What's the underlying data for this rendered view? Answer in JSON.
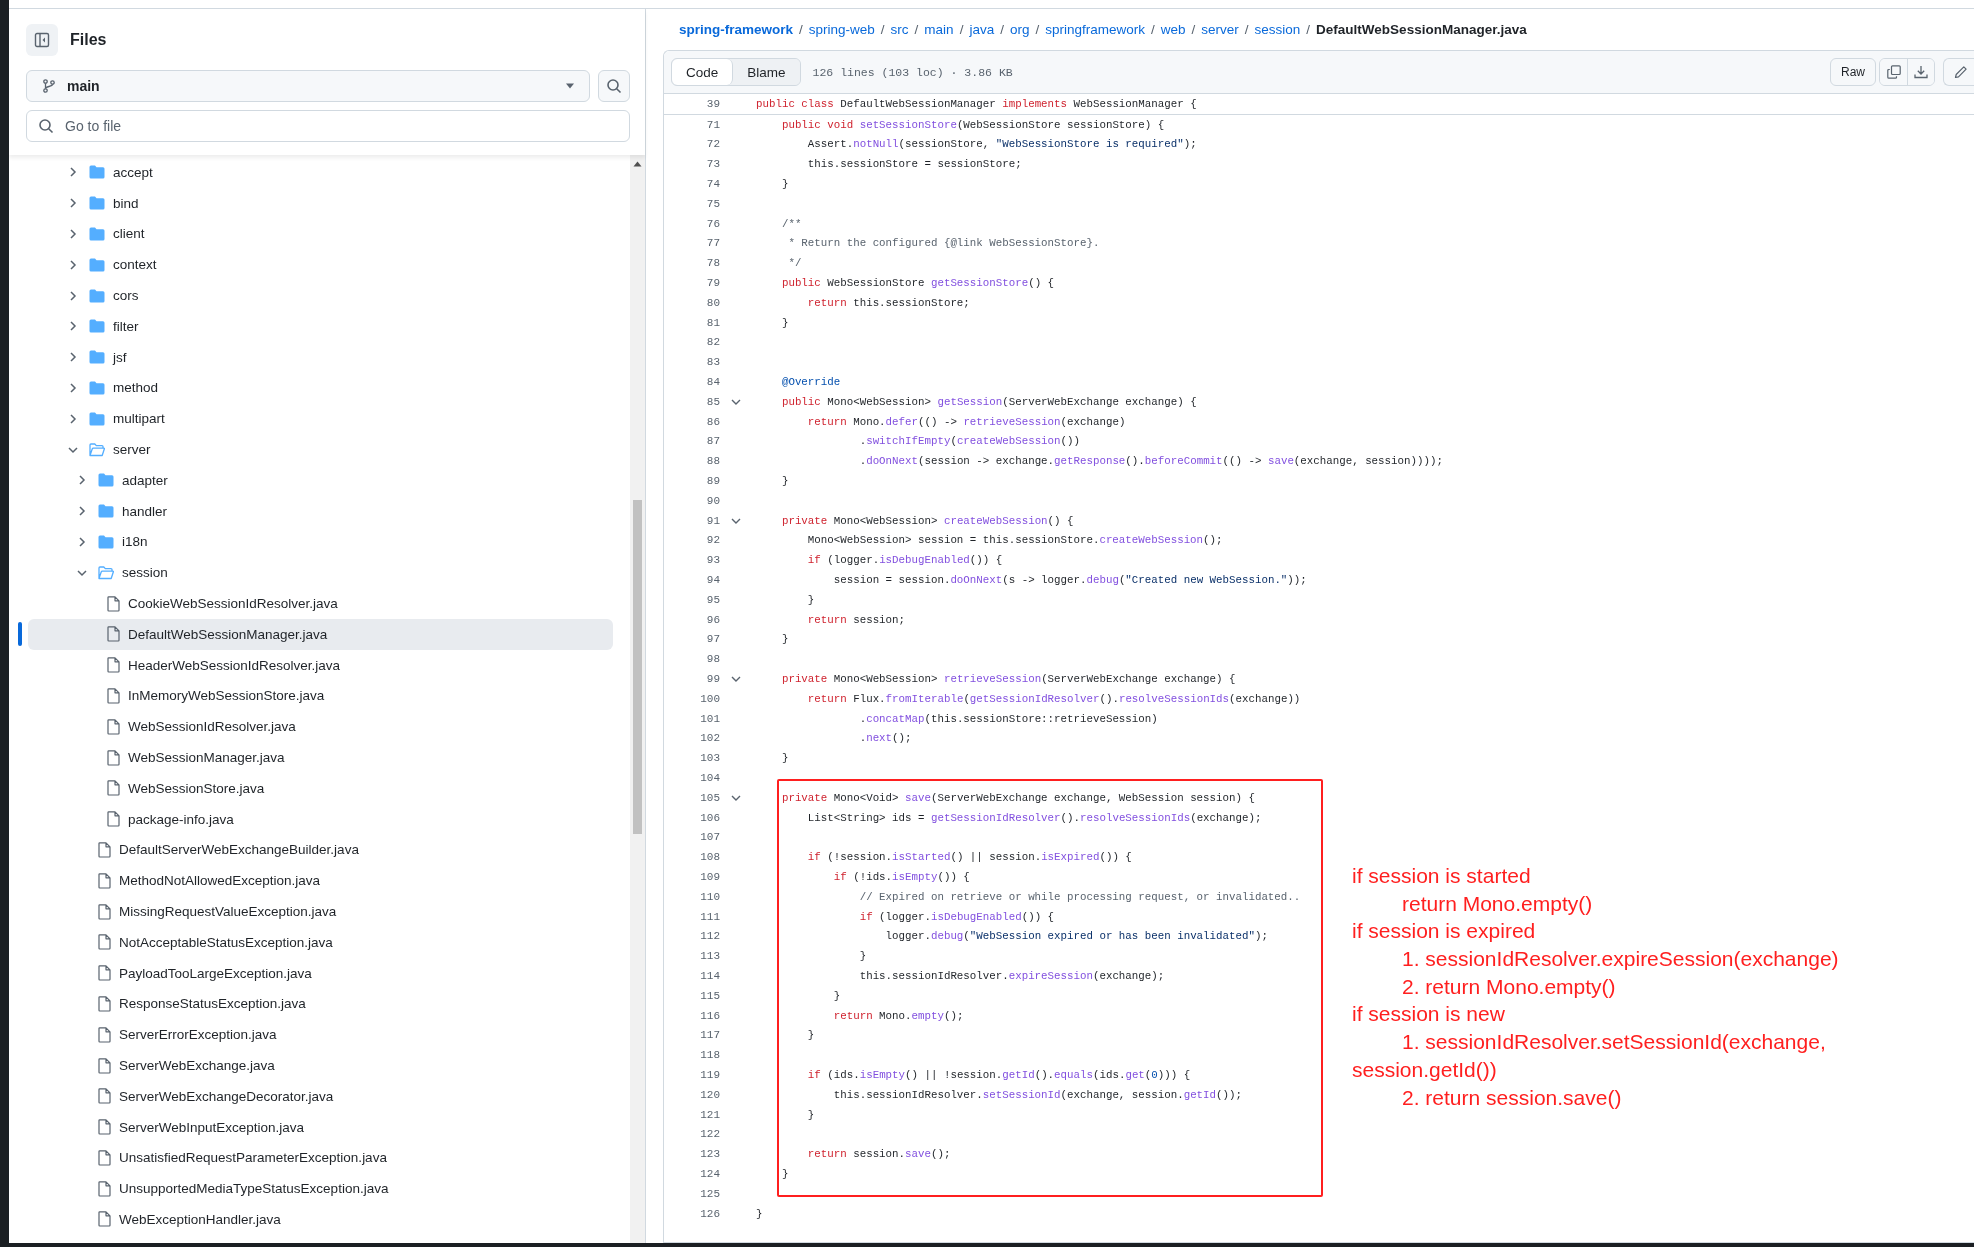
{
  "sidebar": {
    "title": "Files",
    "branch": "main",
    "search": {
      "placeholder": "Go to file"
    },
    "tree": [
      {
        "name": "accept",
        "kind": "folder",
        "expanded": false,
        "selected": false
      },
      {
        "name": "bind",
        "kind": "folder",
        "expanded": false,
        "selected": false
      },
      {
        "name": "client",
        "kind": "folder",
        "expanded": false,
        "selected": false
      },
      {
        "name": "context",
        "kind": "folder",
        "expanded": false,
        "selected": false
      },
      {
        "name": "cors",
        "kind": "folder",
        "expanded": false,
        "selected": false
      },
      {
        "name": "filter",
        "kind": "folder",
        "expanded": false,
        "selected": false
      },
      {
        "name": "jsf",
        "kind": "folder",
        "expanded": false,
        "selected": false
      },
      {
        "name": "method",
        "kind": "folder",
        "expanded": false,
        "selected": false
      },
      {
        "name": "multipart",
        "kind": "folder",
        "expanded": false,
        "selected": false
      },
      {
        "name": "server",
        "kind": "folder",
        "expanded": true,
        "selected": false,
        "children": [
          {
            "name": "adapter",
            "kind": "folder",
            "expanded": false,
            "selected": false
          },
          {
            "name": "handler",
            "kind": "folder",
            "expanded": false,
            "selected": false
          },
          {
            "name": "i18n",
            "kind": "folder",
            "expanded": false,
            "selected": false
          },
          {
            "name": "session",
            "kind": "folder",
            "expanded": true,
            "selected": false,
            "children": [
              {
                "name": "CookieWebSessionIdResolver.java",
                "kind": "file",
                "selected": false
              },
              {
                "name": "DefaultWebSessionManager.java",
                "kind": "file",
                "selected": true
              },
              {
                "name": "HeaderWebSessionIdResolver.java",
                "kind": "file",
                "selected": false
              },
              {
                "name": "InMemoryWebSessionStore.java",
                "kind": "file",
                "selected": false
              },
              {
                "name": "WebSessionIdResolver.java",
                "kind": "file",
                "selected": false
              },
              {
                "name": "WebSessionManager.java",
                "kind": "file",
                "selected": false
              },
              {
                "name": "WebSessionStore.java",
                "kind": "file",
                "selected": false
              },
              {
                "name": "package-info.java",
                "kind": "file",
                "selected": false
              }
            ]
          },
          {
            "name": "DefaultServerWebExchangeBuilder.java",
            "kind": "file",
            "selected": false
          },
          {
            "name": "MethodNotAllowedException.java",
            "kind": "file",
            "selected": false
          },
          {
            "name": "MissingRequestValueException.java",
            "kind": "file",
            "selected": false
          },
          {
            "name": "NotAcceptableStatusException.java",
            "kind": "file",
            "selected": false
          },
          {
            "name": "PayloadTooLargeException.java",
            "kind": "file",
            "selected": false
          },
          {
            "name": "ResponseStatusException.java",
            "kind": "file",
            "selected": false
          },
          {
            "name": "ServerErrorException.java",
            "kind": "file",
            "selected": false
          },
          {
            "name": "ServerWebExchange.java",
            "kind": "file",
            "selected": false
          },
          {
            "name": "ServerWebExchangeDecorator.java",
            "kind": "file",
            "selected": false
          },
          {
            "name": "ServerWebInputException.java",
            "kind": "file",
            "selected": false
          },
          {
            "name": "UnsatisfiedRequestParameterException.java",
            "kind": "file",
            "selected": false
          },
          {
            "name": "UnsupportedMediaTypeStatusException.java",
            "kind": "file",
            "selected": false
          },
          {
            "name": "WebExceptionHandler.java",
            "kind": "file",
            "selected": false
          }
        ]
      }
    ]
  },
  "breadcrumb": [
    {
      "kind": "repo",
      "text": "spring-framework"
    },
    {
      "kind": "separator",
      "text": "/"
    },
    {
      "kind": "link",
      "text": "spring-web"
    },
    {
      "kind": "separator",
      "text": "/"
    },
    {
      "kind": "link",
      "text": "src"
    },
    {
      "kind": "separator",
      "text": "/"
    },
    {
      "kind": "link",
      "text": "main"
    },
    {
      "kind": "separator",
      "text": "/"
    },
    {
      "kind": "link",
      "text": "java"
    },
    {
      "kind": "separator",
      "text": "/"
    },
    {
      "kind": "link",
      "text": "org"
    },
    {
      "kind": "separator",
      "text": "/"
    },
    {
      "kind": "link",
      "text": "springframework"
    },
    {
      "kind": "separator",
      "text": "/"
    },
    {
      "kind": "link",
      "text": "web"
    },
    {
      "kind": "separator",
      "text": "/"
    },
    {
      "kind": "link",
      "text": "server"
    },
    {
      "kind": "separator",
      "text": "/"
    },
    {
      "kind": "link",
      "text": "session"
    },
    {
      "kind": "separator",
      "text": "/"
    },
    {
      "kind": "current",
      "text": "DefaultWebSessionManager.java"
    }
  ],
  "file": {
    "tabs": [
      {
        "label": "Code",
        "selected": true
      },
      {
        "label": "Blame",
        "selected": false
      }
    ],
    "info": "126 lines (103 loc) · 3.86 KB",
    "raw_button": "Raw"
  },
  "code": {
    "sticky": {
      "n": "39",
      "tokens": [
        {
          "kind": "kw",
          "text": "public class"
        },
        {
          "kind": "p",
          "text": " DefaultWebSessionManager "
        },
        {
          "kind": "kw",
          "text": "implements"
        },
        {
          "kind": "p",
          "text": " WebSessionManager {"
        }
      ]
    },
    "blocks": [
      {
        "boxed": false,
        "lines": [
          {
            "n": "71",
            "fold": false,
            "tokens": [
              {
                "kind": "kw",
                "text": "    public void "
              },
              {
                "kind": "fn",
                "text": "setSessionStore"
              },
              {
                "kind": "p",
                "text": "(WebSessionStore sessionStore) {"
              }
            ]
          },
          {
            "n": "72",
            "fold": false,
            "tokens": [
              {
                "kind": "p",
                "text": "        Assert."
              },
              {
                "kind": "fn",
                "text": "notNull"
              },
              {
                "kind": "p",
                "text": "(sessionStore, "
              },
              {
                "kind": "str",
                "text": "\"WebSessionStore is required\""
              },
              {
                "kind": "p",
                "text": ");"
              }
            ]
          },
          {
            "n": "73",
            "fold": false,
            "tokens": [
              {
                "kind": "p",
                "text": "        this.sessionStore = sessionStore;"
              }
            ]
          },
          {
            "n": "74",
            "fold": false,
            "tokens": [
              {
                "kind": "p",
                "text": "    }"
              }
            ]
          },
          {
            "n": "75",
            "fold": false
          },
          {
            "n": "76",
            "fold": false,
            "tokens": [
              {
                "kind": "cm",
                "text": "    /**"
              }
            ]
          },
          {
            "n": "77",
            "fold": false,
            "tokens": [
              {
                "kind": "cm",
                "text": "     * Return the configured {@link WebSessionStore}."
              }
            ]
          },
          {
            "n": "78",
            "fold": false,
            "tokens": [
              {
                "kind": "cm",
                "text": "     */"
              }
            ]
          },
          {
            "n": "79",
            "fold": false,
            "tokens": [
              {
                "kind": "kw",
                "text": "    public"
              },
              {
                "kind": "p",
                "text": " WebSessionStore "
              },
              {
                "kind": "fn",
                "text": "getSessionStore"
              },
              {
                "kind": "p",
                "text": "() {"
              }
            ]
          },
          {
            "n": "80",
            "fold": false,
            "tokens": [
              {
                "kind": "kw",
                "text": "        return"
              },
              {
                "kind": "p",
                "text": " this.sessionStore;"
              }
            ]
          },
          {
            "n": "81",
            "fold": false,
            "tokens": [
              {
                "kind": "p",
                "text": "    }"
              }
            ]
          },
          {
            "n": "82",
            "fold": false
          },
          {
            "n": "83",
            "fold": false
          },
          {
            "n": "84",
            "fold": false,
            "tokens": [
              {
                "kind": "ann",
                "text": "    @Override"
              }
            ]
          },
          {
            "n": "85",
            "fold": true,
            "tokens": [
              {
                "kind": "kw",
                "text": "    public"
              },
              {
                "kind": "p",
                "text": " Mono<WebSession> "
              },
              {
                "kind": "fn",
                "text": "getSession"
              },
              {
                "kind": "p",
                "text": "(ServerWebExchange exchange) {"
              }
            ]
          },
          {
            "n": "86",
            "fold": false,
            "tokens": [
              {
                "kind": "kw",
                "text": "        return"
              },
              {
                "kind": "p",
                "text": " Mono."
              },
              {
                "kind": "fn",
                "text": "defer"
              },
              {
                "kind": "p",
                "text": "(() -> "
              },
              {
                "kind": "fn",
                "text": "retrieveSession"
              },
              {
                "kind": "p",
                "text": "(exchange)"
              }
            ]
          },
          {
            "n": "87",
            "fold": false,
            "tokens": [
              {
                "kind": "p",
                "text": "                ."
              },
              {
                "kind": "fn",
                "text": "switchIfEmpty"
              },
              {
                "kind": "p",
                "text": "("
              },
              {
                "kind": "fn",
                "text": "createWebSession"
              },
              {
                "kind": "p",
                "text": "())"
              }
            ]
          },
          {
            "n": "88",
            "fold": false,
            "tokens": [
              {
                "kind": "p",
                "text": "                ."
              },
              {
                "kind": "fn",
                "text": "doOnNext"
              },
              {
                "kind": "p",
                "text": "(session -> exchange."
              },
              {
                "kind": "fn",
                "text": "getResponse"
              },
              {
                "kind": "p",
                "text": "()."
              },
              {
                "kind": "fn",
                "text": "beforeCommit"
              },
              {
                "kind": "p",
                "text": "(() -> "
              },
              {
                "kind": "fn",
                "text": "save"
              },
              {
                "kind": "p",
                "text": "(exchange, session))));"
              }
            ]
          },
          {
            "n": "89",
            "fold": false,
            "tokens": [
              {
                "kind": "p",
                "text": "    }"
              }
            ]
          },
          {
            "n": "90",
            "fold": false
          },
          {
            "n": "91",
            "fold": true,
            "tokens": [
              {
                "kind": "kw",
                "text": "    private"
              },
              {
                "kind": "p",
                "text": " Mono<WebSession> "
              },
              {
                "kind": "fn",
                "text": "createWebSession"
              },
              {
                "kind": "p",
                "text": "() {"
              }
            ]
          },
          {
            "n": "92",
            "fold": false,
            "tokens": [
              {
                "kind": "p",
                "text": "        Mono<WebSession> session = this.sessionStore."
              },
              {
                "kind": "fn",
                "text": "createWebSession"
              },
              {
                "kind": "p",
                "text": "();"
              }
            ]
          },
          {
            "n": "93",
            "fold": false,
            "tokens": [
              {
                "kind": "kw",
                "text": "        if"
              },
              {
                "kind": "p",
                "text": " (logger."
              },
              {
                "kind": "fn",
                "text": "isDebugEnabled"
              },
              {
                "kind": "p",
                "text": "()) {"
              }
            ]
          },
          {
            "n": "94",
            "fold": false,
            "tokens": [
              {
                "kind": "p",
                "text": "            session = session."
              },
              {
                "kind": "fn",
                "text": "doOnNext"
              },
              {
                "kind": "p",
                "text": "(s -> logger."
              },
              {
                "kind": "fn",
                "text": "debug"
              },
              {
                "kind": "p",
                "text": "("
              },
              {
                "kind": "str",
                "text": "\"Created new WebSession.\""
              },
              {
                "kind": "p",
                "text": "));"
              }
            ]
          },
          {
            "n": "95",
            "fold": false,
            "tokens": [
              {
                "kind": "p",
                "text": "        }"
              }
            ]
          },
          {
            "n": "96",
            "fold": false,
            "tokens": [
              {
                "kind": "kw",
                "text": "        return"
              },
              {
                "kind": "p",
                "text": " session;"
              }
            ]
          },
          {
            "n": "97",
            "fold": false,
            "tokens": [
              {
                "kind": "p",
                "text": "    }"
              }
            ]
          },
          {
            "n": "98",
            "fold": false
          },
          {
            "n": "99",
            "fold": true,
            "tokens": [
              {
                "kind": "kw",
                "text": "    private"
              },
              {
                "kind": "p",
                "text": " Mono<WebSession> "
              },
              {
                "kind": "fn",
                "text": "retrieveSession"
              },
              {
                "kind": "p",
                "text": "(ServerWebExchange exchange) {"
              }
            ]
          },
          {
            "n": "100",
            "fold": false,
            "tokens": [
              {
                "kind": "kw",
                "text": "        return"
              },
              {
                "kind": "p",
                "text": " Flux."
              },
              {
                "kind": "fn",
                "text": "fromIterable"
              },
              {
                "kind": "p",
                "text": "("
              },
              {
                "kind": "fn",
                "text": "getSessionIdResolver"
              },
              {
                "kind": "p",
                "text": "()."
              },
              {
                "kind": "fn",
                "text": "resolveSessionIds"
              },
              {
                "kind": "p",
                "text": "(exchange))"
              }
            ]
          },
          {
            "n": "101",
            "fold": false,
            "tokens": [
              {
                "kind": "p",
                "text": "                ."
              },
              {
                "kind": "fn",
                "text": "concatMap"
              },
              {
                "kind": "p",
                "text": "(this.sessionStore::retrieveSession)"
              }
            ]
          },
          {
            "n": "102",
            "fold": false,
            "tokens": [
              {
                "kind": "p",
                "text": "                ."
              },
              {
                "kind": "fn",
                "text": "next"
              },
              {
                "kind": "p",
                "text": "();"
              }
            ]
          },
          {
            "n": "103",
            "fold": false,
            "tokens": [
              {
                "kind": "p",
                "text": "    }"
              }
            ]
          },
          {
            "n": "104",
            "fold": false
          }
        ]
      },
      {
        "boxed": true,
        "lines": [
          {
            "n": "105",
            "fold": true,
            "tokens": [
              {
                "kind": "kw",
                "text": "    private"
              },
              {
                "kind": "p",
                "text": " Mono<Void> "
              },
              {
                "kind": "fn",
                "text": "save"
              },
              {
                "kind": "p",
                "text": "(ServerWebExchange exchange, WebSession session) {"
              }
            ]
          },
          {
            "n": "106",
            "fold": false,
            "tokens": [
              {
                "kind": "p",
                "text": "        List<String> ids = "
              },
              {
                "kind": "fn",
                "text": "getSessionIdResolver"
              },
              {
                "kind": "p",
                "text": "()."
              },
              {
                "kind": "fn",
                "text": "resolveSessionIds"
              },
              {
                "kind": "p",
                "text": "(exchange);"
              }
            ]
          },
          {
            "n": "107",
            "fold": false
          },
          {
            "n": "108",
            "fold": false,
            "tokens": [
              {
                "kind": "kw",
                "text": "        if"
              },
              {
                "kind": "p",
                "text": " (!session."
              },
              {
                "kind": "fn",
                "text": "isStarted"
              },
              {
                "kind": "p",
                "text": "() || session."
              },
              {
                "kind": "fn",
                "text": "isExpired"
              },
              {
                "kind": "p",
                "text": "()) {"
              }
            ]
          },
          {
            "n": "109",
            "fold": false,
            "tokens": [
              {
                "kind": "kw",
                "text": "            if"
              },
              {
                "kind": "p",
                "text": " (!ids."
              },
              {
                "kind": "fn",
                "text": "isEmpty"
              },
              {
                "kind": "p",
                "text": "()) {"
              }
            ]
          },
          {
            "n": "110",
            "fold": false,
            "tokens": [
              {
                "kind": "cm",
                "text": "                // Expired on retrieve or while processing request, or invalidated.."
              }
            ]
          },
          {
            "n": "111",
            "fold": false,
            "tokens": [
              {
                "kind": "kw",
                "text": "                if"
              },
              {
                "kind": "p",
                "text": " (logger."
              },
              {
                "kind": "fn",
                "text": "isDebugEnabled"
              },
              {
                "kind": "p",
                "text": "()) {"
              }
            ]
          },
          {
            "n": "112",
            "fold": false,
            "tokens": [
              {
                "kind": "p",
                "text": "                    logger."
              },
              {
                "kind": "fn",
                "text": "debug"
              },
              {
                "kind": "p",
                "text": "("
              },
              {
                "kind": "str",
                "text": "\"WebSession expired or has been invalidated\""
              },
              {
                "kind": "p",
                "text": ");"
              }
            ]
          },
          {
            "n": "113",
            "fold": false,
            "tokens": [
              {
                "kind": "p",
                "text": "                }"
              }
            ]
          },
          {
            "n": "114",
            "fold": false,
            "tokens": [
              {
                "kind": "p",
                "text": "                this.sessionIdResolver."
              },
              {
                "kind": "fn",
                "text": "expireSession"
              },
              {
                "kind": "p",
                "text": "(exchange);"
              }
            ]
          },
          {
            "n": "115",
            "fold": false,
            "tokens": [
              {
                "kind": "p",
                "text": "            }"
              }
            ]
          },
          {
            "n": "116",
            "fold": false,
            "tokens": [
              {
                "kind": "kw",
                "text": "            return"
              },
              {
                "kind": "p",
                "text": " Mono."
              },
              {
                "kind": "fn",
                "text": "empty"
              },
              {
                "kind": "p",
                "text": "();"
              }
            ]
          },
          {
            "n": "117",
            "fold": false,
            "tokens": [
              {
                "kind": "p",
                "text": "        }"
              }
            ]
          },
          {
            "n": "118",
            "fold": false
          },
          {
            "n": "119",
            "fold": false,
            "tokens": [
              {
                "kind": "kw",
                "text": "        if"
              },
              {
                "kind": "p",
                "text": " (ids."
              },
              {
                "kind": "fn",
                "text": "isEmpty"
              },
              {
                "kind": "p",
                "text": "() || !session."
              },
              {
                "kind": "fn",
                "text": "getId"
              },
              {
                "kind": "p",
                "text": "()."
              },
              {
                "kind": "fn",
                "text": "equals"
              },
              {
                "kind": "p",
                "text": "(ids."
              },
              {
                "kind": "fn",
                "text": "get"
              },
              {
                "kind": "p",
                "text": "("
              },
              {
                "kind": "num",
                "text": "0"
              },
              {
                "kind": "p",
                "text": "))) {"
              }
            ]
          },
          {
            "n": "120",
            "fold": false,
            "tokens": [
              {
                "kind": "p",
                "text": "            this.sessionIdResolver."
              },
              {
                "kind": "fn",
                "text": "setSessionId"
              },
              {
                "kind": "p",
                "text": "(exchange, session."
              },
              {
                "kind": "fn",
                "text": "getId"
              },
              {
                "kind": "p",
                "text": "());"
              }
            ]
          },
          {
            "n": "121",
            "fold": false,
            "tokens": [
              {
                "kind": "p",
                "text": "        }"
              }
            ]
          },
          {
            "n": "122",
            "fold": false
          },
          {
            "n": "123",
            "fold": false,
            "tokens": [
              {
                "kind": "kw",
                "text": "        return"
              },
              {
                "kind": "p",
                "text": " session."
              },
              {
                "kind": "fn",
                "text": "save"
              },
              {
                "kind": "p",
                "text": "();"
              }
            ]
          },
          {
            "n": "124",
            "fold": false,
            "tokens": [
              {
                "kind": "p",
                "text": "    }"
              }
            ]
          }
        ],
        "notes": [
          {
            "text": "if session is started",
            "indent": false
          },
          {
            "text": "return Mono.empty()",
            "indent": true
          },
          {
            "text": "if session is expired",
            "indent": false
          },
          {
            "text": "1. sessionIdResolver.expireSession(exchange)",
            "indent": true
          },
          {
            "text": "2. return Mono.empty()",
            "indent": true
          },
          {
            "text": "if session is new",
            "indent": false
          },
          {
            "text": "1. sessionIdResolver.setSessionId(exchange, session.getId())",
            "indent": true
          },
          {
            "text": "2. return session.save()",
            "indent": true
          }
        ]
      },
      {
        "boxed": false,
        "lines": [
          {
            "n": "125",
            "fold": false
          },
          {
            "n": "126",
            "fold": false,
            "tokens": [
              {
                "kind": "p",
                "text": "}"
              }
            ]
          }
        ]
      }
    ]
  }
}
